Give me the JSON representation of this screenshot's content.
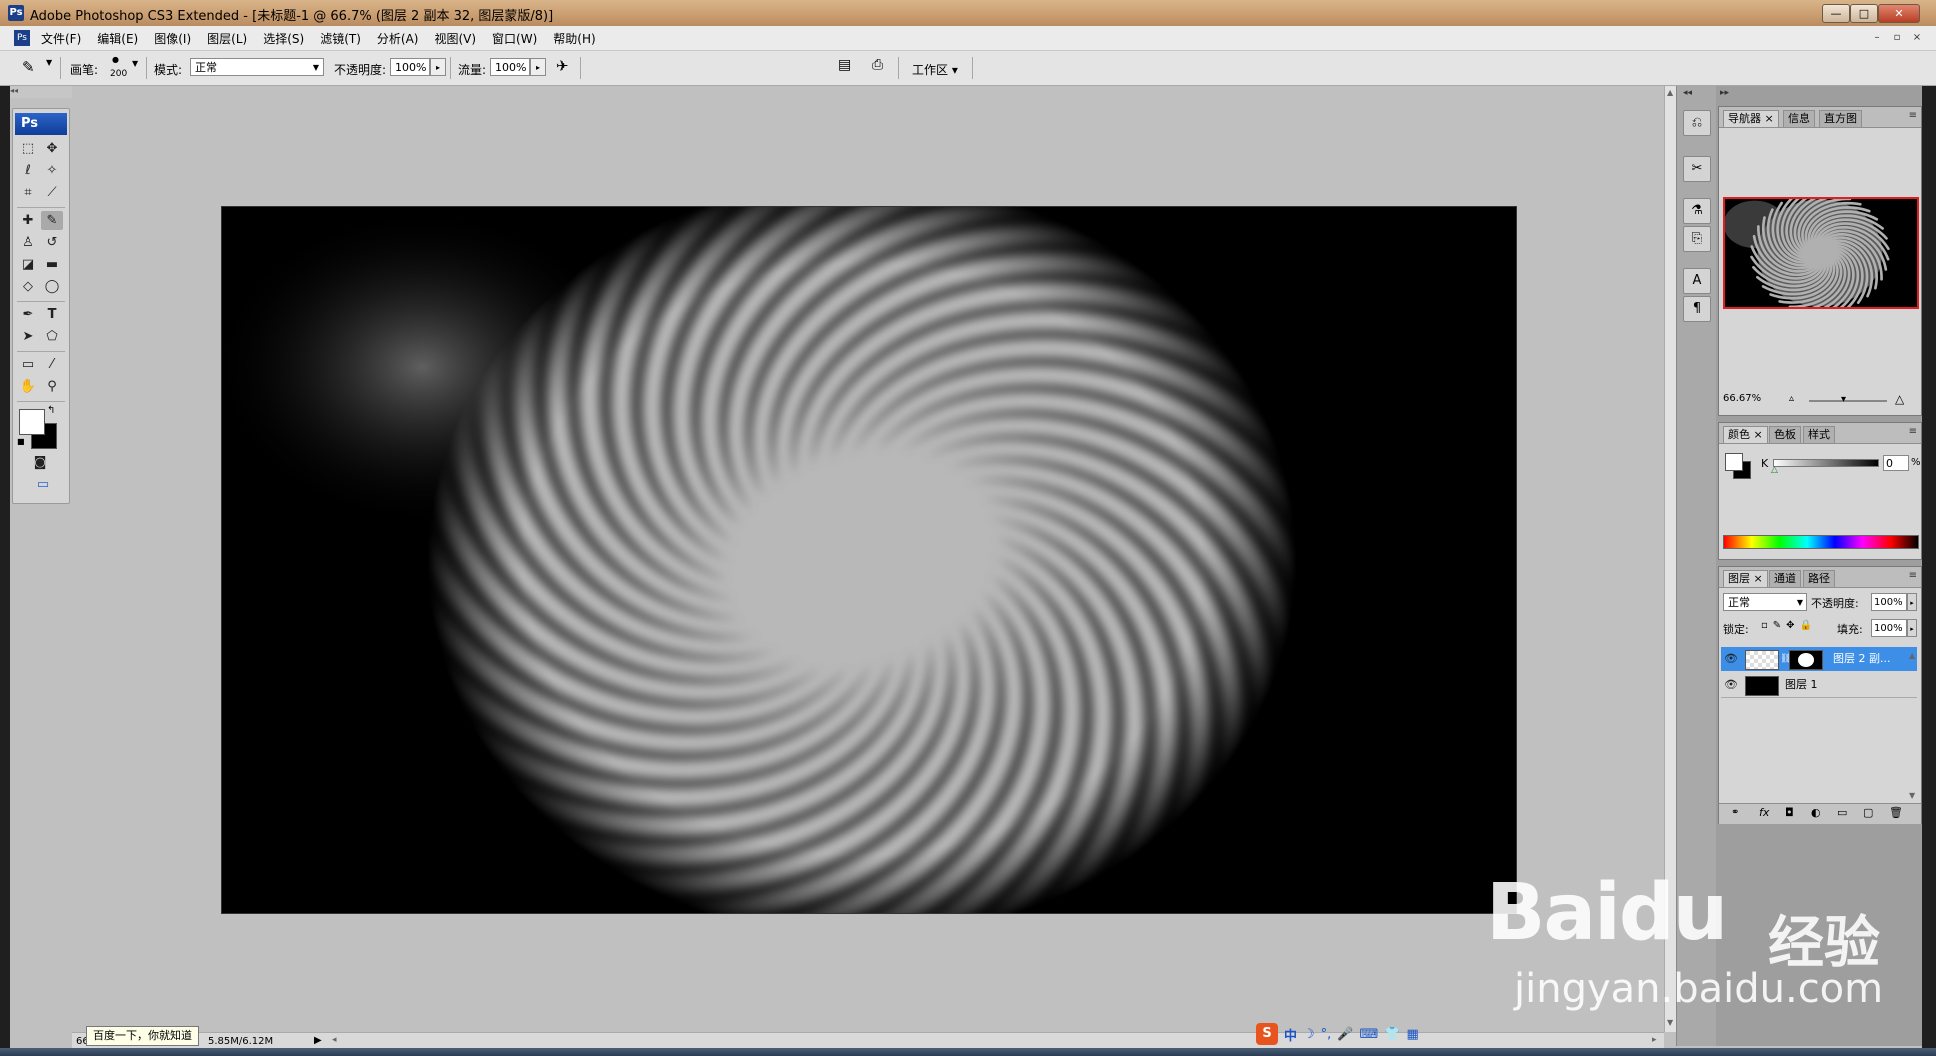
{
  "window": {
    "title": "Adobe Photoshop CS3 Extended - [未标题-1 @ 66.7% (图层 2 副本 32, 图层蒙版/8)]",
    "app_icon": "Ps",
    "controls": {
      "minimize": "—",
      "maximize": "□",
      "close": "✕"
    }
  },
  "menubar": {
    "items": [
      "文件(F)",
      "编辑(E)",
      "图像(I)",
      "图层(L)",
      "选择(S)",
      "滤镜(T)",
      "分析(A)",
      "视图(V)",
      "窗口(W)",
      "帮助(H)"
    ]
  },
  "options": {
    "brush_label": "画笔:",
    "brush_size": "200",
    "mode_label": "模式:",
    "mode_value": "正常",
    "opacity_label": "不透明度:",
    "opacity_value": "100%",
    "flow_label": "流量:",
    "flow_value": "100%",
    "workspace_label": "工作区 ▾"
  },
  "toolbox": {
    "badge": "Ps"
  },
  "statusbar": {
    "zoom": "66",
    "doc_size": "5.85M/6.12M",
    "tooltip": "百度一下，你就知道"
  },
  "navigator": {
    "tabs": [
      "导航器",
      "信息",
      "直方图"
    ],
    "zoom": "66.67%"
  },
  "color_panel": {
    "tabs": [
      "颜色",
      "色板",
      "样式"
    ],
    "channel_label": "K",
    "value": "0",
    "unit": "%"
  },
  "layers_panel": {
    "tabs": [
      "图层",
      "通道",
      "路径"
    ],
    "blend_mode": "正常",
    "opacity_label": "不透明度:",
    "opacity_value": "100%",
    "lock_label": "锁定:",
    "fill_label": "填充:",
    "fill_value": "100%",
    "layers": [
      {
        "name": "图层 2 副...",
        "selected": true
      },
      {
        "name": "图层 1",
        "selected": false
      }
    ],
    "footer_icons": [
      "link-icon",
      "fx-icon",
      "mask-icon",
      "adjustment-icon",
      "group-icon",
      "new-layer-icon",
      "trash-icon"
    ]
  },
  "ime": {
    "logo": "S",
    "items": [
      "中",
      "☽",
      "°,",
      "🎤",
      "⌨",
      "👕",
      "▦"
    ]
  },
  "watermark": {
    "brand": "Baidu",
    "suffix": "经验",
    "url": "jingyan.baidu.com"
  }
}
